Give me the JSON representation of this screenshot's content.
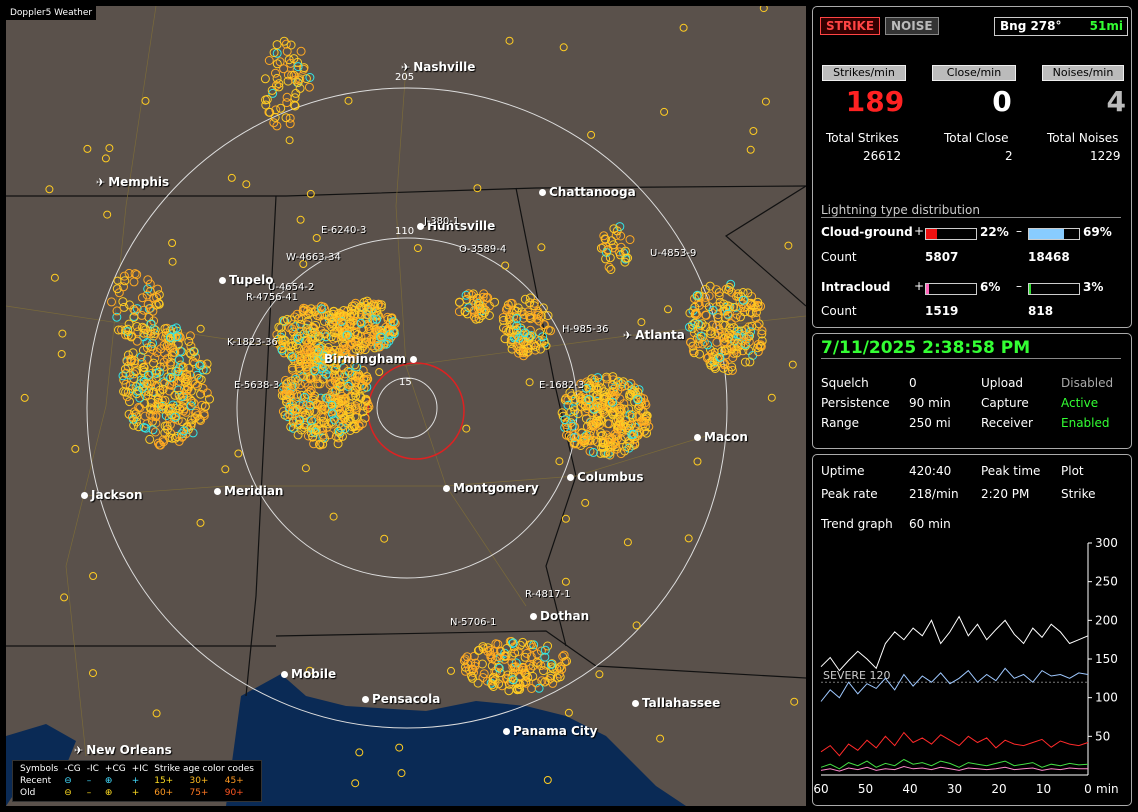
{
  "map": {
    "brand": "Doppler5 Weather",
    "ring_labels": [
      "205",
      "110",
      "15"
    ],
    "cities": [
      {
        "id": "nashville",
        "name": "Nashville",
        "kind": "plane"
      },
      {
        "id": "memphis",
        "name": "Memphis",
        "kind": "plane"
      },
      {
        "id": "chattanooga",
        "name": "Chattanooga",
        "kind": "dot"
      },
      {
        "id": "huntsville",
        "name": "Huntsville",
        "kind": "dot"
      },
      {
        "id": "tupelo",
        "name": "Tupelo",
        "kind": "dot"
      },
      {
        "id": "birmingham",
        "name": "Birmingham",
        "kind": "dot"
      },
      {
        "id": "atlanta",
        "name": "Atlanta",
        "kind": "plane"
      },
      {
        "id": "macon",
        "name": "Macon",
        "kind": "dot"
      },
      {
        "id": "jackson",
        "name": "Jackson",
        "kind": "dot"
      },
      {
        "id": "meridian",
        "name": "Meridian",
        "kind": "dot"
      },
      {
        "id": "montgomery",
        "name": "Montgomery",
        "kind": "dot"
      },
      {
        "id": "columbus",
        "name": "Columbus",
        "kind": "dot"
      },
      {
        "id": "dothan",
        "name": "Dothan",
        "kind": "dot"
      },
      {
        "id": "mobile",
        "name": "Mobile",
        "kind": "dot"
      },
      {
        "id": "pensacola",
        "name": "Pensacola",
        "kind": "dot"
      },
      {
        "id": "tallahassee",
        "name": "Tallahassee",
        "kind": "dot"
      },
      {
        "id": "panama",
        "name": "Panama City",
        "kind": "dot"
      },
      {
        "id": "neworleans",
        "name": "New Orleans",
        "kind": "plane"
      }
    ],
    "storm_labels": [
      "E-6240-3",
      "J-380-1",
      "W-4663-34",
      "U-4654-2",
      "R-4756-41",
      "K-1823-36",
      "E-5638-3",
      "O-3589-4",
      "U-4853-9",
      "H-985-36",
      "E-1682-3",
      "R-4817-1",
      "N-5706-1"
    ],
    "legend": {
      "title": "Symbols",
      "cols": [
        "-CG",
        "-IC",
        "+CG",
        "+IC"
      ],
      "age_title": "Strike age color codes",
      "recent": "Recent",
      "old": "Old",
      "ages_recent": [
        "15+",
        "30+",
        "45+"
      ],
      "ages_old": [
        "60+",
        "75+",
        "90+"
      ],
      "sym_neg_cg": "⊖",
      "sym_neg_ic": "–",
      "sym_pos_cg": "⊕",
      "sym_pos_ic": "+"
    }
  },
  "panel": {
    "strike_btn": "STRIKE",
    "noise_btn": "NOISE",
    "bearing": "Bng 278°",
    "distance": "51mi",
    "strikes_min_lbl": "Strikes/min",
    "close_min_lbl": "Close/min",
    "noises_min_lbl": "Noises/min",
    "strikes_min": "189",
    "close_min": "0",
    "noises_min": "4",
    "total_strikes_lbl": "Total Strikes",
    "total_close_lbl": "Total Close",
    "total_noises_lbl": "Total Noises",
    "total_strikes": "26612",
    "total_close": "2",
    "total_noises": "1229",
    "dist_title": "Lightning type distribution",
    "cg_lbl": "Cloud-ground",
    "ic_lbl": "Intracloud",
    "count_lbl": "Count",
    "plus": "+",
    "minus": "–",
    "cg_pos_pct": "22%",
    "cg_neg_pct": "69%",
    "cg_pos_count": "5807",
    "cg_neg_count": "18468",
    "ic_pos_pct": "6%",
    "ic_neg_pct": "3%",
    "ic_pos_count": "1519",
    "ic_neg_count": "818",
    "cg_pos_frac": 0.22,
    "cg_neg_frac": 0.69,
    "ic_pos_frac": 0.06,
    "ic_neg_frac": 0.03
  },
  "status": {
    "datetime": "7/11/2025 2:38:58 PM",
    "squelch_lbl": "Squelch",
    "squelch": "0",
    "persist_lbl": "Persistence",
    "persist": "90 min",
    "range_lbl": "Range",
    "range": "250 mi",
    "upload_lbl": "Upload",
    "upload": "Disabled",
    "capture_lbl": "Capture",
    "capture": "Active",
    "receiver_lbl": "Receiver",
    "receiver": "Enabled"
  },
  "stats": {
    "uptime_lbl": "Uptime",
    "uptime": "420:40",
    "peaktime_lbl": "Peak time",
    "plot_lbl": "Plot",
    "peakrate_lbl": "Peak rate",
    "peakrate": "218/min",
    "peaktime": "2:20 PM",
    "plot": "Strike",
    "trend_lbl": "Trend graph",
    "trend": "60 min",
    "severe": "SEVERE 120",
    "xunit": "min"
  },
  "chart_data": {
    "type": "line",
    "xlabel": "min",
    "x_ticks": [
      60,
      50,
      40,
      30,
      20,
      10,
      0
    ],
    "y_ticks": [
      50,
      100,
      150,
      200,
      250,
      300
    ],
    "ylim": [
      0,
      300
    ],
    "threshold": 120,
    "series": [
      {
        "color": "#ffffff",
        "values": [
          140,
          152,
          135,
          148,
          160,
          150,
          138,
          170,
          185,
          175,
          190,
          180,
          200,
          170,
          185,
          205,
          180,
          195,
          175,
          188,
          200,
          182,
          170,
          190,
          178,
          195,
          185,
          170,
          175,
          180
        ]
      },
      {
        "color": "#9ec8ff",
        "values": [
          95,
          110,
          100,
          120,
          105,
          118,
          112,
          125,
          110,
          130,
          115,
          128,
          120,
          132,
          118,
          125,
          135,
          120,
          130,
          122,
          138,
          125,
          130,
          120,
          135,
          128,
          130,
          125,
          132,
          130
        ]
      },
      {
        "color": "#ff2a2a",
        "values": [
          30,
          38,
          25,
          40,
          32,
          45,
          35,
          50,
          38,
          55,
          42,
          48,
          40,
          52,
          45,
          38,
          50,
          42,
          48,
          35,
          45,
          40,
          38,
          42,
          46,
          36,
          44,
          40,
          38,
          42
        ]
      },
      {
        "color": "#44dd44",
        "values": [
          10,
          14,
          8,
          16,
          12,
          18,
          10,
          15,
          12,
          20,
          14,
          16,
          12,
          18,
          15,
          10,
          16,
          14,
          12,
          15,
          18,
          12,
          14,
          16,
          10,
          14,
          12,
          15,
          13,
          14
        ]
      },
      {
        "color": "#ff88cc",
        "values": [
          6,
          8,
          5,
          9,
          7,
          10,
          6,
          8,
          7,
          11,
          8,
          9,
          7,
          10,
          8,
          6,
          9,
          8,
          7,
          8,
          10,
          7,
          8,
          9,
          6,
          8,
          7,
          9,
          8,
          8
        ]
      }
    ]
  }
}
